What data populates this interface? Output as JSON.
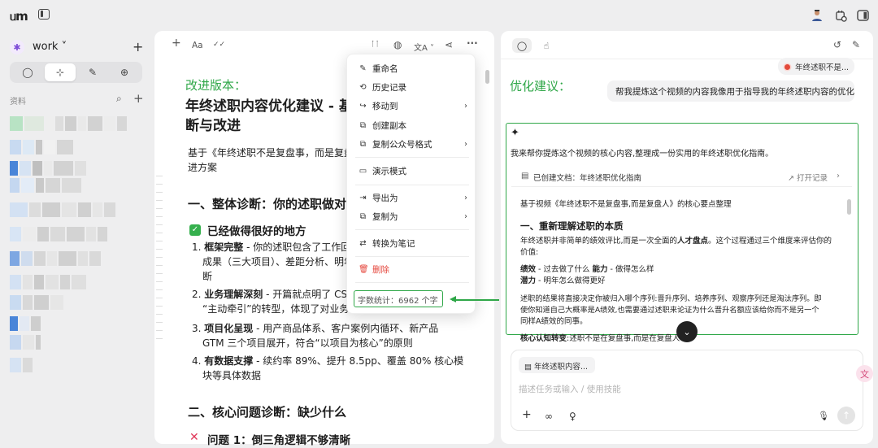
{
  "app": {
    "logo": "ᥙm"
  },
  "sidebar": {
    "workspace": "work ˅",
    "add": "+",
    "modes": [
      "◯",
      "⊹",
      "✎",
      "⊕"
    ],
    "library_label": "资料",
    "search_icon": "⌕",
    "library_add": "+"
  },
  "doc_toolbar": {
    "add": "+",
    "font": "Aa",
    "check": "✓✓",
    "ai": "ᛙᛙ",
    "palette": "◍",
    "translate": "文A ˅",
    "share": "⋖",
    "more": "···"
  },
  "doc": {
    "version_label": "改进版本：",
    "title_line1": "年终述职内容优化建议 - 基",
    "title_line2": "断与改进",
    "intro_line1": "基于《年终述职不是复盘事，而是复盘",
    "intro_line2": "进方案",
    "h2_1": "一、整体诊断：你的述职做对",
    "h3_1": "已经做得很好的地方",
    "items": [
      {
        "num": "1.",
        "bold": "框架完整",
        "rest": " - 你的述职包含了工作回顾",
        "line2": "成果（三大项目）、差距分析、明年",
        "line3": "断"
      },
      {
        "num": "2.",
        "bold": "业务理解深刻",
        "rest": " - 开篇就点明了 CSM",
        "line2": "“主动牵引”的转型，体现了对业务"
      },
      {
        "num": "3.",
        "bold": "项目化呈现",
        "rest": " - 用产商品体系、客户案例内循环、新产品",
        "line2": "GTM 三个项目展开，符合“以项目为核心”的原则"
      },
      {
        "num": "4.",
        "bold": "有数据支撑",
        "rest": " - 续约率 89%、提升 8.5pp、覆盖 80% 核心模",
        "line2": "块等具体数据"
      }
    ],
    "h2_2": "二、核心问题诊断：缺少什么",
    "h3_2": "问题 1：倒三角逻辑不够清晰"
  },
  "menu": {
    "items": [
      {
        "icon": "✎",
        "label": "重命名"
      },
      {
        "icon": "⟲",
        "label": "历史记录"
      },
      {
        "icon": "↪",
        "label": "移动到",
        "arrow": "›"
      },
      {
        "icon": "⧉",
        "label": "创建副本"
      },
      {
        "icon": "⧉",
        "label": "复制公众号格式",
        "arrow": "›"
      },
      {
        "icon": "▭",
        "label": "演示模式"
      },
      {
        "icon": "⇥",
        "label": "导出为",
        "arrow": "›"
      },
      {
        "icon": "⧉",
        "label": "复制为",
        "arrow": "›"
      },
      {
        "icon": "⇄",
        "label": "转换为笔记"
      },
      {
        "icon": "🗑",
        "label": "删除"
      }
    ],
    "word_count": "字数统计：6962 个字"
  },
  "chat": {
    "tab_a": "◯",
    "tab_b": "☝",
    "history_icon": "↺",
    "edit_icon": "✎",
    "ref_pill": "年终述职不是...",
    "user_message": "帮我提炼这个视频的内容我像用于指导我的年终述职内容的优化",
    "suggest_label": "优化建议：",
    "ai_intro": "我来帮你提炼这个视频的核心内容,整理成一份实用的年终述职优化指南。",
    "doc_card": {
      "text": "已创建文档：年终述职优化指南",
      "open": "↗ 打开记录",
      "chev": "›"
    },
    "ai_content": {
      "p1": "基于视频《年终述职不是复盘事,而是复盘人》的核心要点整理",
      "h1": "一、重新理解述职的本质",
      "p2a": "年终述职并非简单的绩效评比,而是一次全面的",
      "p2b": "人才盘点",
      "p2c": "。这个过程通过三个维度来评估你的",
      "p2d": "价值:",
      "l1a": "绩效",
      "l1b": " - 过去做了什么 ",
      "l1c": "能力",
      "l1d": " - 做得怎么样",
      "l2a": "潜力",
      "l2b": " - 明年怎么做得更好",
      "p3a": "述职的结果将直接决定你被归入哪个序列:晋升序列、培养序列、观察序列还是淘汰序列。即",
      "p3b": "使你知道自己大概率是A绩效,也需要通过述职来论证为什么晋升名额应该给你而不是另一个",
      "p3c": "同样A绩效的同事。",
      "p4a": "核心认知转变",
      "p4b": ":述职不是在复盘事,而是在复盘人"
    },
    "scroll_down": "⌄",
    "attach_chip": "年终述职内容...",
    "input_placeholder": "描述任务或输入 / 使用技能",
    "btn_add": "+",
    "btn_link": "∞",
    "btn_bulb": "♀",
    "btn_mic": "🎙",
    "btn_send": "↑"
  },
  "colors": {
    "accent_green": "#2fa748",
    "danger": "#e5473d"
  }
}
